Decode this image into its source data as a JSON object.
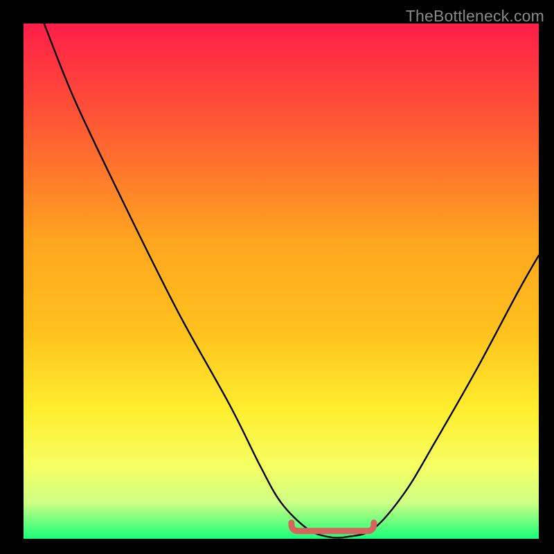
{
  "watermark": "TheBottleneck.com",
  "colors": {
    "frame_bg": "#000000",
    "gradient_top": "#ff1e49",
    "gradient_mid_upper": "#ff6a2a",
    "gradient_mid": "#ffc21e",
    "gradient_mid_lower": "#ffe730",
    "gradient_low": "#f5ff6a",
    "gradient_green_fade": "#bfff86",
    "gradient_bottom": "#19ff7a",
    "curve_stroke": "#000000",
    "trough_stroke": "#d6655e"
  },
  "chart_data": {
    "type": "line",
    "title": "",
    "xlabel": "",
    "ylabel": "",
    "xlim": [
      0,
      100
    ],
    "ylim": [
      0,
      100
    ],
    "series": [
      {
        "name": "bottleneck-curve",
        "x": [
          4,
          10,
          20,
          30,
          40,
          46,
          50,
          55,
          59,
          63,
          68,
          74,
          80,
          88,
          96,
          100
        ],
        "y": [
          100,
          85,
          64,
          44,
          26,
          14,
          7,
          2,
          0.4,
          0.4,
          2,
          9,
          19,
          33,
          48,
          55
        ]
      }
    ],
    "annotations": [
      {
        "name": "trough-marker",
        "x_range": [
          52,
          68
        ],
        "y": 1.5,
        "note": "pink rounded bracket highlighting the valley floor"
      }
    ]
  }
}
